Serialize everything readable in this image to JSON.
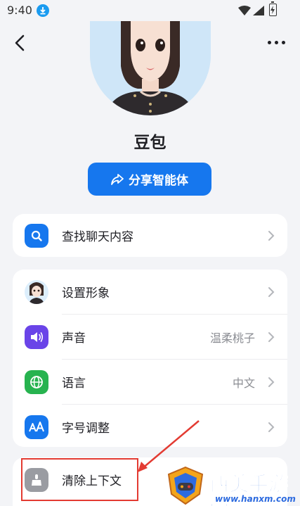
{
  "status_bar": {
    "time": "9:40"
  },
  "bot": {
    "name": "豆包"
  },
  "share_button": {
    "label": "分享智能体"
  },
  "search_row": {
    "label": "查找聊天内容"
  },
  "settings": [
    {
      "label": "设置形象",
      "value": "",
      "icon": "avatar-thumb"
    },
    {
      "label": "声音",
      "value": "温柔桃子",
      "icon": "speaker-icon"
    },
    {
      "label": "语言",
      "value": "中文",
      "icon": "globe-icon"
    },
    {
      "label": "字号调整",
      "value": "",
      "icon": "font-size-icon"
    }
  ],
  "clear_row": {
    "label": "清除上下文",
    "icon": "broom-icon"
  },
  "watermark": {
    "title": "西美手游网",
    "url": "www.hanxm.com"
  },
  "colors": {
    "primary": "#1677ee",
    "search_icon_bg": "#1677ee",
    "speaker_icon_bg": "#6a44e8",
    "globe_icon_bg": "#27b34f",
    "font_icon_bg": "#1677ee",
    "broom_icon_bg": "#9a9ca2",
    "annotation": "#e33b32"
  }
}
